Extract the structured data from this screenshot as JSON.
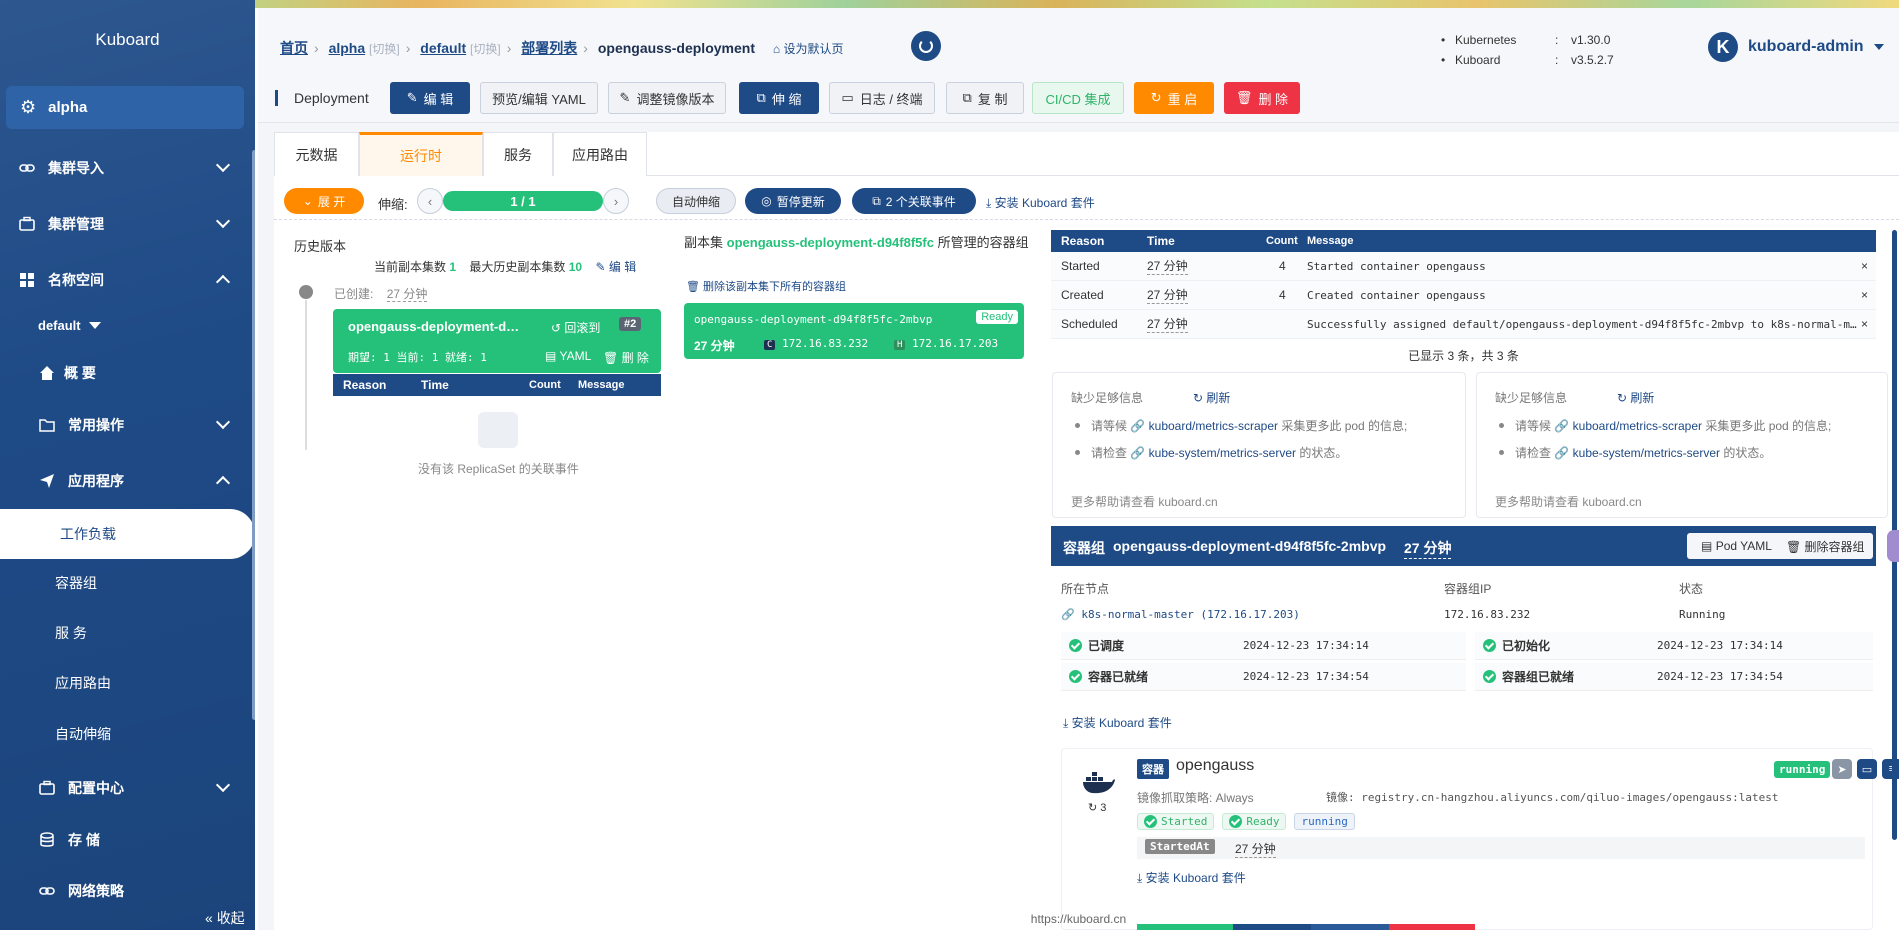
{
  "app": {
    "name": "Kuboard",
    "footer_url": "https://kuboard.cn"
  },
  "sidebar": {
    "active_cluster": "alpha",
    "items": [
      {
        "label": "集群导入"
      },
      {
        "label": "集群管理"
      },
      {
        "label": "名称空间"
      }
    ],
    "namespace": "default",
    "ns_items": [
      {
        "label": "概 要"
      },
      {
        "label": "常用操作"
      },
      {
        "label": "应用程序"
      }
    ],
    "app_items": [
      {
        "label": "工作负载"
      },
      {
        "label": "容器组"
      },
      {
        "label": "服 务"
      },
      {
        "label": "应用路由"
      },
      {
        "label": "自动伸缩"
      }
    ],
    "bottom_items": [
      {
        "label": "配置中心"
      },
      {
        "label": "存 储"
      },
      {
        "label": "网络策略"
      }
    ],
    "collapse": "收起"
  },
  "breadcrumb": {
    "home": "首页",
    "cluster": "alpha",
    "switch": "[切换]",
    "namespace": "default",
    "list": "部署列表",
    "current": "opengauss-deployment",
    "set_default": "设为默认页"
  },
  "kinfo": {
    "k8s_label": "Kubernetes",
    "k8s_ver": "v1.30.0",
    "kb_label": "Kuboard",
    "kb_ver": "v3.5.2.7"
  },
  "user": {
    "initial": "K",
    "name": "kuboard-admin"
  },
  "toolbar": {
    "kind": "Deployment",
    "edit": "编 辑",
    "yaml": "预览/编辑 YAML",
    "image": "调整镜像版本",
    "scale": "伸 缩",
    "logs": "日志 / 终端",
    "copy": "复 制",
    "cicd": "CI/CD 集成",
    "restart": "重 启",
    "delete": "删 除"
  },
  "tabs": [
    "元数据",
    "运行时",
    "服务",
    "应用路由"
  ],
  "controls": {
    "expand": "展 开",
    "scale_label": "伸缩:",
    "replicas": "1 / 1",
    "autoscale": "自动伸缩",
    "pause": "暂停更新",
    "events": "2 个关联事件",
    "install": "安装 Kuboard 套件"
  },
  "history": {
    "title": "历史版本",
    "cur_label": "当前副本集数",
    "cur_value": "1",
    "max_label": "最大历史副本集数",
    "max_value": "10",
    "edit": "编 辑",
    "created_label": "已创建:",
    "created_value": "27 分钟",
    "rs_name": "opengauss-deployment-d…",
    "rollback": "回滚到",
    "revision": "#2",
    "status": "期望: 1 当前: 1 就绪: 1",
    "yaml": "YAML",
    "delete": "删 除",
    "empty": "没有该 ReplicaSet 的关联事件"
  },
  "event_cols": {
    "reason": "Reason",
    "time": "Time",
    "count": "Count",
    "message": "Message"
  },
  "replicaset": {
    "prefix": "副本集",
    "name": "opengauss-deployment-d94f8f5fc",
    "suffix": "所管理的容器组",
    "delete_all": "删除该副本集下所有的容器组",
    "pod_name": "opengauss-deployment-d94f8f5fc-2mbvp",
    "ready": "Ready",
    "age": "27 分钟",
    "c_ip": "172.16.83.232",
    "h_ip": "172.16.17.203"
  },
  "events": [
    {
      "reason": "Started",
      "time": "27 分钟",
      "count": "4",
      "message": "Started container opengauss"
    },
    {
      "reason": "Created",
      "time": "27 分钟",
      "count": "4",
      "message": "Created container opengauss"
    },
    {
      "reason": "Scheduled",
      "time": "27 分钟",
      "count": "",
      "message": "Successfully assigned default/opengauss-deployment-d94f8f5fc-2mbvp to k8s-normal-m…"
    }
  ],
  "events_summary": "已显示 3 条，共 3 条",
  "metrics": {
    "title": "缺少足够信息",
    "refresh": "刷新",
    "wait": "请等候",
    "scraper": "kuboard/metrics-scraper",
    "collect": "采集更多此 pod 的信息;",
    "check": "请检查",
    "server": "kube-system/metrics-server",
    "status": "的状态。",
    "help": "更多帮助请查看 kuboard.cn"
  },
  "pod": {
    "label": "容器组",
    "name": "opengauss-deployment-d94f8f5fc-2mbvp",
    "age": "27 分钟",
    "pod_yaml": "Pod YAML",
    "delete": "删除容器组",
    "node_label": "所在节点",
    "ip_label": "容器组IP",
    "state_label": "状态",
    "node": "k8s-normal-master (172.16.17.203)",
    "ip": "172.16.83.232",
    "state": "Running",
    "conditions": [
      {
        "label": "已调度",
        "time": "2024-12-23 17:34:14"
      },
      {
        "label": "已初始化",
        "time": "2024-12-23 17:34:14"
      },
      {
        "label": "容器已就绪",
        "time": "2024-12-23 17:34:54"
      },
      {
        "label": "容器组已就绪",
        "time": "2024-12-23 17:34:54"
      }
    ],
    "install": "安装 Kuboard 套件"
  },
  "container": {
    "tag": "容器",
    "name": "opengauss",
    "state": "running",
    "restarts": "3",
    "pull_policy": "镜像抓取策略: Always",
    "image": "镜像: registry.cn-hangzhou.aliyuncs.com/qiluo-images/opengauss:latest",
    "started": "Started",
    "ready": "Ready",
    "running": "running",
    "started_at": "StartedAt",
    "started_at_val": "27 分钟",
    "install": "安装 Kuboard 套件"
  }
}
